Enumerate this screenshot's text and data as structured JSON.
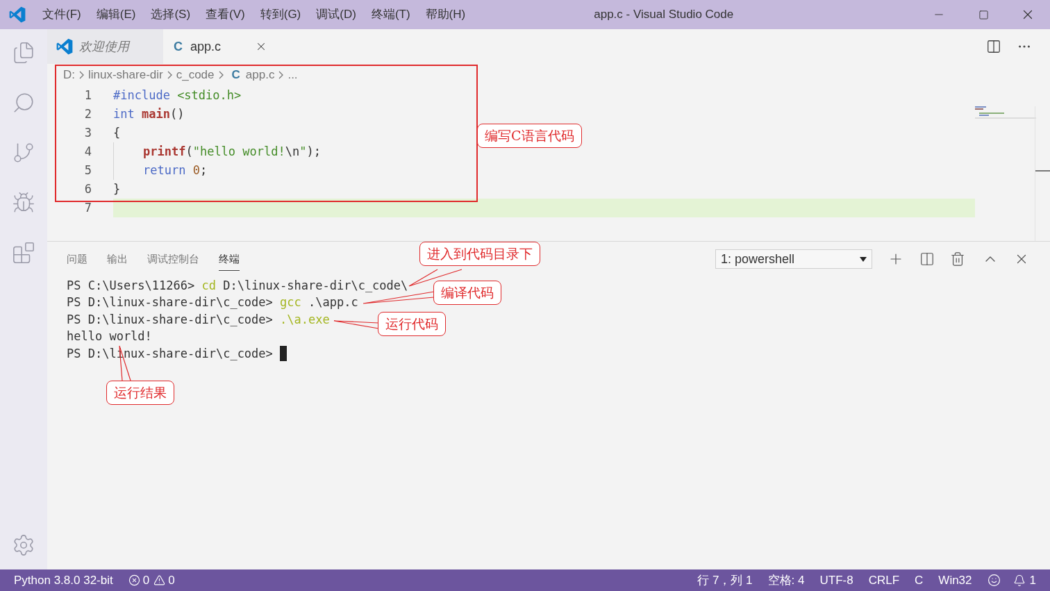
{
  "title_bar": {
    "menus": [
      "文件(F)",
      "编辑(E)",
      "选择(S)",
      "查看(V)",
      "转到(G)",
      "调试(D)",
      "终端(T)",
      "帮助(H)"
    ],
    "title": "app.c - Visual Studio Code"
  },
  "tabs": [
    {
      "label": "欢迎使用",
      "kind": "welcome",
      "selected": false
    },
    {
      "label": "app.c",
      "kind": "c",
      "icon_text": "C",
      "selected": true
    }
  ],
  "breadcrumbs": [
    {
      "label": "D:"
    },
    {
      "label": "linux-share-dir"
    },
    {
      "label": "c_code"
    },
    {
      "label": "app.c",
      "icon_text": "C"
    },
    {
      "label": "..."
    }
  ],
  "editor": {
    "lines": [
      {
        "number": "1",
        "current": false,
        "indent": false,
        "tokens": [
          {
            "kind": "keyword",
            "text": "#include"
          },
          {
            "kind": "string",
            "text": " <stdio.h>"
          }
        ]
      },
      {
        "number": "2",
        "current": false,
        "indent": false,
        "tokens": [
          {
            "kind": "keyword",
            "text": "int "
          },
          {
            "kind": "function",
            "text": "main"
          },
          {
            "kind": "plain",
            "text": "()"
          }
        ]
      },
      {
        "number": "3",
        "current": false,
        "indent": false,
        "tokens": [
          {
            "kind": "plain",
            "text": "{"
          }
        ]
      },
      {
        "number": "4",
        "current": false,
        "indent": true,
        "tokens": [
          {
            "kind": "function",
            "text": "printf"
          },
          {
            "kind": "plain",
            "text": "("
          },
          {
            "kind": "string",
            "text": "\"hello world!"
          },
          {
            "kind": "plain",
            "text": "\\n"
          },
          {
            "kind": "string",
            "text": "\""
          },
          {
            "kind": "plain",
            "text": ");"
          }
        ]
      },
      {
        "number": "5",
        "current": false,
        "indent": true,
        "tokens": [
          {
            "kind": "keyword",
            "text": "return "
          },
          {
            "kind": "number",
            "text": "0"
          },
          {
            "kind": "plain",
            "text": ";"
          }
        ]
      },
      {
        "number": "6",
        "current": false,
        "indent": false,
        "tokens": [
          {
            "kind": "plain",
            "text": "}"
          }
        ]
      },
      {
        "number": "7",
        "current": true,
        "indent": false
      }
    ]
  },
  "panel": {
    "tabs": [
      {
        "label": "问题",
        "selected": false
      },
      {
        "label": "输出",
        "selected": false
      },
      {
        "label": "调试控制台",
        "selected": false
      },
      {
        "label": "终端",
        "selected": true
      }
    ],
    "terminal_select": "1: powershell",
    "lines": [
      [
        {
          "kind": "plain",
          "text": "PS C:\\Users\\11266> "
        },
        {
          "kind": "command",
          "text": "cd"
        },
        {
          "kind": "plain",
          "text": " D:\\linux-share-dir\\c_code\\"
        }
      ],
      [
        {
          "kind": "plain",
          "text": "PS D:\\linux-share-dir\\c_code> "
        },
        {
          "kind": "command",
          "text": "gcc"
        },
        {
          "kind": "plain",
          "text": " .\\app.c"
        }
      ],
      [
        {
          "kind": "plain",
          "text": "PS D:\\linux-share-dir\\c_code> "
        },
        {
          "kind": "command",
          "text": ".\\a.exe"
        }
      ],
      [
        {
          "kind": "plain",
          "text": "hello world!"
        }
      ],
      [
        {
          "kind": "plain",
          "text": "PS D:\\linux-share-dir\\c_code> "
        },
        {
          "kind": "cursor"
        }
      ]
    ]
  },
  "annotations": [
    "编写C语言代码",
    "进入到代码目录下",
    "编译代码",
    "运行代码",
    "运行结果"
  ],
  "status_bar": {
    "interpreter": "Python 3.8.0 32-bit",
    "errors": "0",
    "warnings": "0",
    "position": "行 7，列 1",
    "indent": "空格: 4",
    "encoding": "UTF-8",
    "eol": "CRLF",
    "language": "C",
    "platform": "Win32",
    "notifications": "1"
  }
}
